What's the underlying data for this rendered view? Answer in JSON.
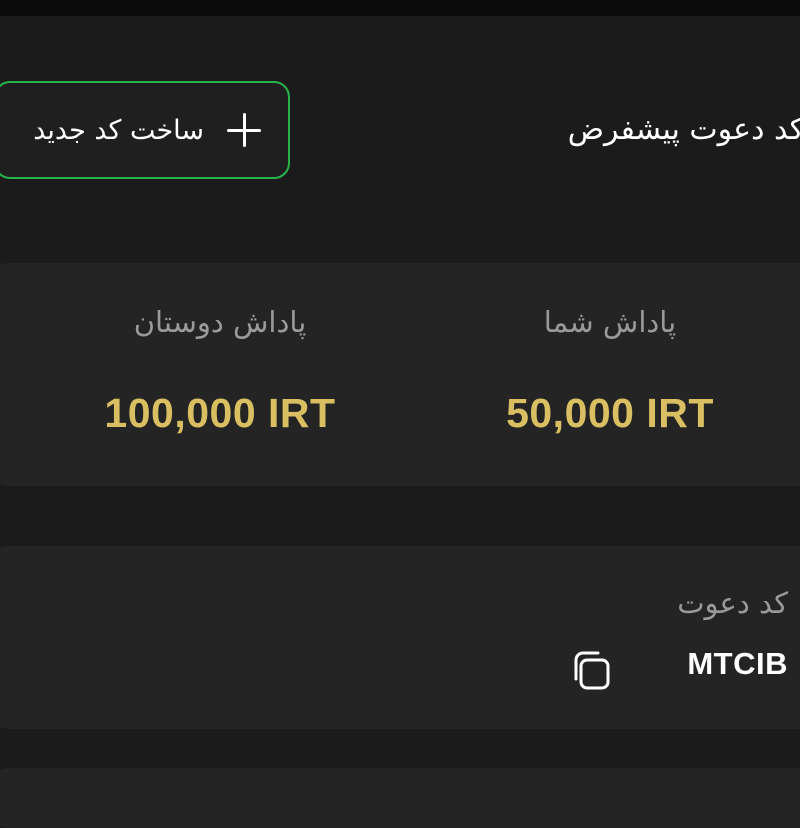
{
  "header": {
    "title": "کد دعوت پیشفرض"
  },
  "actions": {
    "new_code_label": "ساخت کد جدید",
    "new_code_icon": "plus-icon",
    "accent_color": "#27b34a"
  },
  "rewards": {
    "friends": {
      "label": "پاداش دوستان",
      "value": "100,000 IRT"
    },
    "yours": {
      "label": "پاداش شما",
      "value": "50,000 IRT"
    },
    "value_color": "#d9bf62"
  },
  "invite_code": {
    "label": "کد دعوت",
    "value": "MTCIB",
    "copy_icon": "copy-icon"
  }
}
